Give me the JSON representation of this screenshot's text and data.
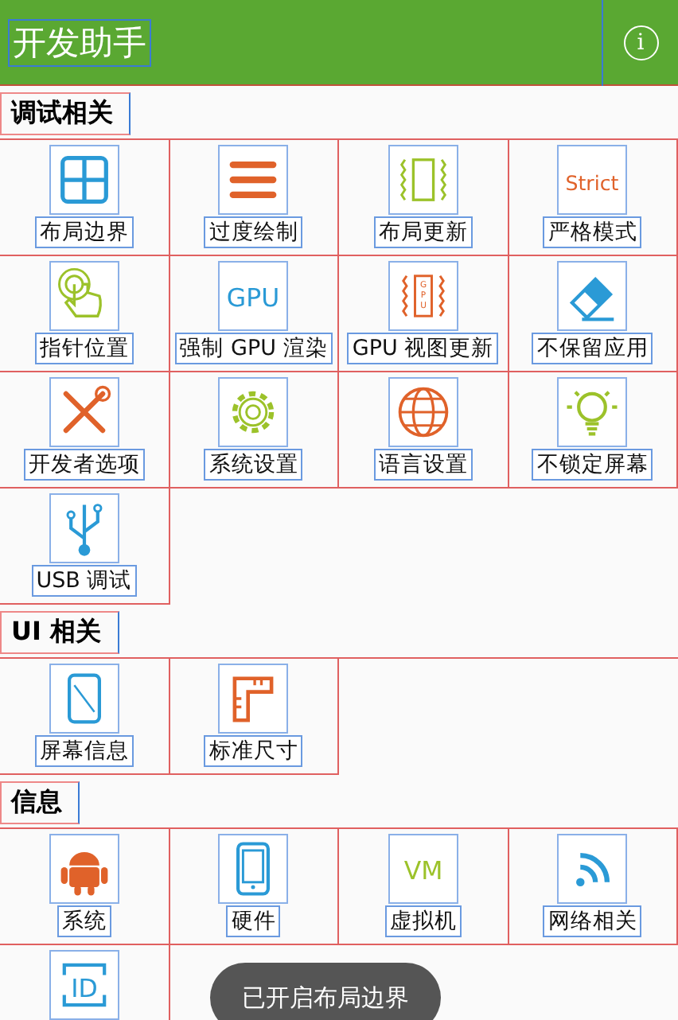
{
  "app_bar": {
    "title": "开发助手",
    "info_icon": "i"
  },
  "sections": [
    {
      "title": "调试相关",
      "items": [
        {
          "label": "布局边界"
        },
        {
          "label": "过度绘制"
        },
        {
          "label": "布局更新"
        },
        {
          "label": "严格模式",
          "icon_text": "Strict"
        },
        {
          "label": "指针位置"
        },
        {
          "label": "强制 GPU 渲染",
          "icon_text": "GPU"
        },
        {
          "label": "GPU 视图更新",
          "icon_text": "GPU"
        },
        {
          "label": "不保留应用"
        },
        {
          "label": "开发者选项"
        },
        {
          "label": "系统设置"
        },
        {
          "label": "语言设置"
        },
        {
          "label": "不锁定屏幕"
        },
        {
          "label": "USB 调试"
        }
      ]
    },
    {
      "title": "UI 相关",
      "items": [
        {
          "label": "屏幕信息"
        },
        {
          "label": "标准尺寸"
        }
      ]
    },
    {
      "title": "信息",
      "items": [
        {
          "label": "系统"
        },
        {
          "label": "硬件"
        },
        {
          "label": "虚拟机",
          "icon_text": "VM"
        },
        {
          "label": "网络相关"
        },
        {
          "icon_text": "ID"
        }
      ]
    }
  ],
  "toast": "已开启布局边界"
}
